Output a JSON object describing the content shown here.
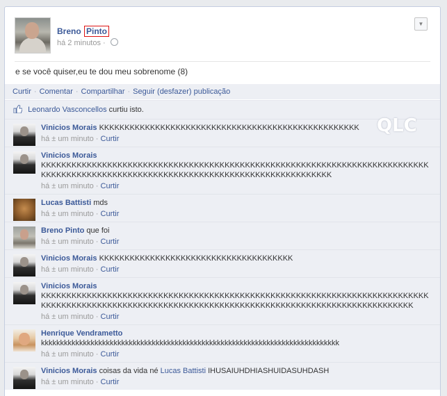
{
  "post": {
    "author_first": "Breno",
    "author_last": "Pinto",
    "timestamp": "há 2 minutos",
    "separator": "·",
    "text": "e se você quiser,eu te dou meu sobrenome (8)",
    "actions": [
      "Curtir",
      "Comentar",
      "Compartilhar",
      "Seguir (desfazer) publicação"
    ],
    "likes": {
      "name": "Leonardo Vasconcellos",
      "suffix": "curtiu isto."
    }
  },
  "watermark": "QLC",
  "comments": [
    {
      "author": "Vinicios Morais",
      "text": "KKKKKKKKKKKKKKKKKKKKKKKKKKKKKKKKKKKKKKKKKKKKKKKKKKK",
      "time": "há ± um minuto",
      "like": "Curtir"
    },
    {
      "author": "Vinicios Morais",
      "text": "KKKKKKKKKKKKKKKKKKKKKKKKKKKKKKKKKKKKKKKKKKKKKKKKKKKKKKKKKKKKKKKKKKKKKKKKKKKKKKKKKKKKKKKKKKKKKKKKKKKKKKKKKKKKKKKKKKKKKKKKKKKKKKKKKKKKK",
      "time": "há ± um minuto",
      "like": "Curtir"
    },
    {
      "author": "Lucas Battisti",
      "text": "mds",
      "time": "há ± um minuto",
      "like": "Curtir"
    },
    {
      "author": "Breno Pinto",
      "text": "que foi",
      "time": "há ± um minuto",
      "like": "Curtir"
    },
    {
      "author": "Vinicios Morais",
      "text": "KKKKKKKKKKKKKKKKKKKKKKKKKKKKKKKKKKKKKK",
      "time": "há ± um minuto",
      "like": "Curtir"
    },
    {
      "author": "Vinicios Morais",
      "text": "KKKKKKKKKKKKKKKKKKKKKKKKKKKKKKKKKKKKKKKKKKKKKKKKKKKKKKKKKKKKKKKKKKKKKKKKKKKKKKKKKKKKKKKKKKKKKKKKKKKKKKKKKKKKKKKKKKKKKKKKKKKKKKKKKKKKKKKKKKKKKKKKKKKKK",
      "time": "há ± um minuto",
      "like": "Curtir"
    },
    {
      "author": "Henrique Vendrametto",
      "text": "kkkkkkkkkkkkkkkkkkkkkkkkkkkkkkkkkkkkkkkkkkkkkkkkkkkkkkkkkkkkkkkkkkkkkkkkkkkkkk",
      "time": "há ± um minuto",
      "like": "Curtir"
    },
    {
      "author": "Vinicios Morais",
      "text_before": "coisas da vida né",
      "mention": "Lucas Battisti",
      "text_after": "IHUSAIUHDHIASHUIDASUHDASH",
      "time": "há ± um minuto",
      "like": "Curtir"
    }
  ]
}
